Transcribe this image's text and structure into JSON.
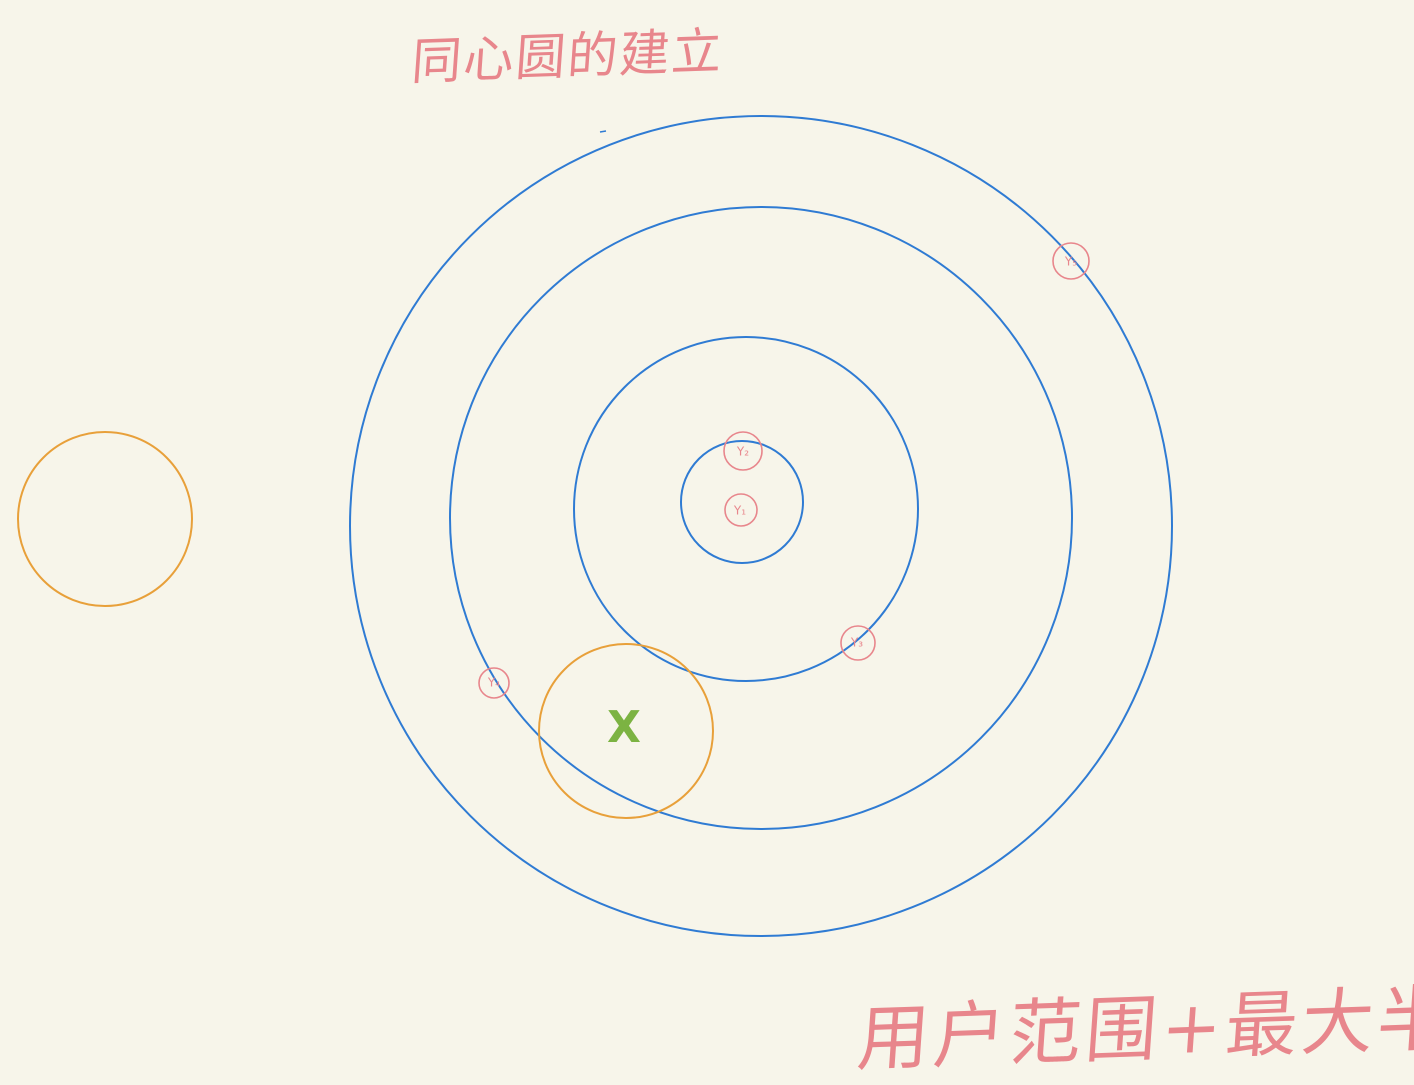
{
  "title": "同心圆的建立",
  "note": "用户范围+最大半径",
  "colors": {
    "background": "#f7f5ea",
    "concentric": "#2f7bd3",
    "orange": "#e8a03a",
    "marker": "#e8868c",
    "x_mark": "#7cb342"
  },
  "points": [
    {
      "id": "y1",
      "label": "Y₁"
    },
    {
      "id": "y2",
      "label": "Y₂"
    },
    {
      "id": "y3",
      "label": "Y₃"
    },
    {
      "id": "y4",
      "label": "Y₄"
    },
    {
      "id": "y5",
      "label": "Y₅"
    }
  ],
  "user_point": {
    "label": "X"
  }
}
